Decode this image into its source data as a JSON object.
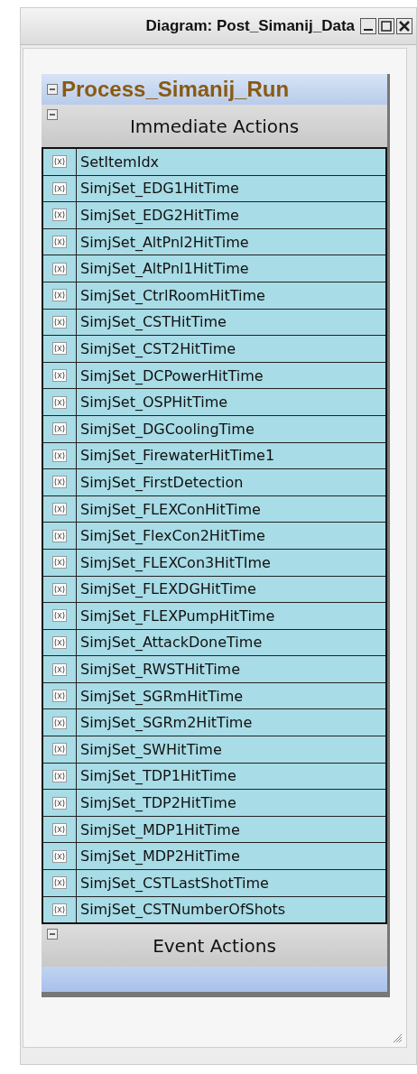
{
  "window": {
    "title": "Diagram: Post_Simanij_Data"
  },
  "process": {
    "title": "Process_Simanij_Run",
    "expanded": true,
    "sections": [
      {
        "title": "Immediate Actions",
        "expanded": true,
        "actions": [
          "SetItemIdx",
          "SimjSet_EDG1HitTime",
          "SimjSet_EDG2HitTime",
          "SimjSet_AltPnl2HitTime",
          "SimjSet_AltPnl1HitTime",
          "SimjSet_CtrlRoomHitTime",
          "SimjSet_CSTHitTime",
          "SimjSet_CST2HitTime",
          "SimjSet_DCPowerHitTime",
          "SimjSet_OSPHitTime",
          "SimjSet_DGCoolingTime",
          "SimjSet_FirewaterHitTime1",
          "SimjSet_FirstDetection",
          "SimjSet_FLEXConHitTime",
          "SimjSet_FlexCon2HitTime",
          "SimjSet_FLEXCon3HitTIme",
          "SimjSet_FLEXDGHitTime",
          "SimjSet_FLEXPumpHitTime",
          "SimjSet_AttackDoneTime",
          "SimjSet_RWSTHitTime",
          "SimjSet_SGRmHitTime",
          "SimjSet_SGRm2HitTime",
          "SimjSet_SWHitTime",
          "SimjSet_TDP1HitTime",
          "SimjSet_TDP2HitTime",
          "SimjSet_MDP1HitTime",
          "SimjSet_MDP2HitTime",
          "SimjSet_CSTLastShotTime",
          "SimjSet_CSTNumberOfShots"
        ]
      },
      {
        "title": "Event Actions",
        "expanded": true
      }
    ]
  }
}
